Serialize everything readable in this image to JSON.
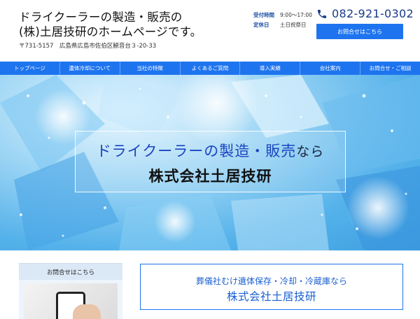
{
  "header": {
    "title_line1": "ドライクーラーの製造・販売の",
    "title_line2": "(株)土居技研のホームページです。",
    "address": "〒731-5157　広島県広島市佐伯区観音台３-20-33",
    "hours_label": "受付時間",
    "hours_value": "9:00～17:00",
    "closed_label": "定休日",
    "closed_value": "土日祝祭日",
    "phone": "082-921-0302",
    "contact_button": "お問合せはこちら"
  },
  "nav": {
    "items": [
      {
        "label": "トップページ"
      },
      {
        "label": "遺体冷却について"
      },
      {
        "label": "当社の特徴"
      },
      {
        "label": "よくあるご質問"
      },
      {
        "label": "導入実績"
      },
      {
        "label": "会社案内"
      },
      {
        "label": "お問合せ・ご相談"
      }
    ]
  },
  "hero": {
    "line1_main": "ドライクーラーの製造・販売",
    "line1_suffix": "なら",
    "line2": "株式会社土居技研"
  },
  "sidebar": {
    "title": "お問合せはこちら"
  },
  "main": {
    "subtitle": "葬儀社むけ遺体保存・冷却・冷蔵庫なら",
    "title": "株式会社土居技研"
  },
  "colors": {
    "accent": "#1e74ef",
    "title_blue": "#1a44c0",
    "phone_blue": "#1a3b8a"
  },
  "icons": {
    "phone": "phone-icon"
  }
}
